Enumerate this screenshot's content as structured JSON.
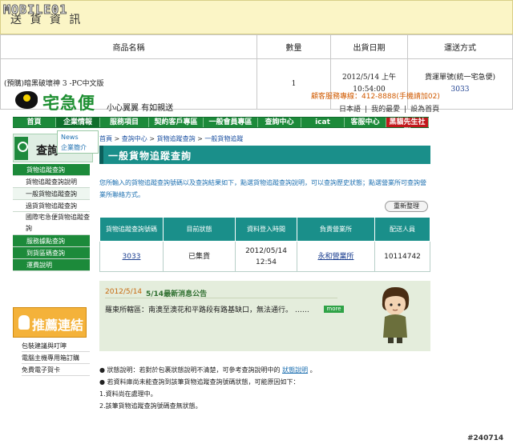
{
  "watermark": "MOBILE01",
  "shipping": {
    "title": "送 貨 資 訊",
    "headers": [
      "商品名稱",
      "數量",
      "出貨日期",
      "運送方式"
    ],
    "row": {
      "product": "(預購)暗黑破壞神 3 -PC中文版",
      "qty": "1",
      "date1": "2012/5/14 上午",
      "date2": "10:54:00",
      "method": "貨運單號(統一宅急便)",
      "tracking": "3033"
    }
  },
  "site": {
    "logo": "宅急便",
    "slogan": "小心翼翼 有如親送",
    "hotline": "顧客服務專線：412-8888(手機請加02)",
    "links": [
      "日本語",
      "我的最愛",
      "設為首頁"
    ],
    "nav": [
      "首頁",
      "企業情報",
      "服務項目",
      "契約客戶專區",
      "一般會員專區",
      "查詢中心",
      "icat",
      "客服中心",
      "黑貓先生社群"
    ],
    "dropdown": {
      "news": "News",
      "about": "企業簡介"
    }
  },
  "sidebar": {
    "title": "查詢",
    "items": [
      "貨物追蹤查詢",
      "貨物追蹤查詢說明",
      "一般貨物追蹤查詢",
      "過貨貨物追蹤查詢",
      "國際宅急便貨物追蹤查詢",
      "服務據點查詢",
      "到貨區碼查詢",
      "運費說明"
    ]
  },
  "recommend": {
    "title": "推薦連結",
    "items": [
      "包裝建議與叮嚀",
      "電腦主機專用箱訂購",
      "免費電子賀卡"
    ]
  },
  "main": {
    "breadcrumb": [
      "首頁",
      "查詢中心",
      "貨物追蹤查詢",
      "一般貨物追蹤"
    ],
    "heading": "一般貨物追蹤查詢",
    "desc": "您所輸入的貨物追蹤查詢號碼以及查詢結果如下，點選貨物追蹤查詢說明，可以查詢歷史狀態；點選營業所可查詢營業所聯絡方式。",
    "refresh": "重新整理",
    "table": {
      "headers": [
        "貨物追蹤查詢號碼",
        "目前狀態",
        "資料登入時間",
        "負責營業所",
        "配送人員"
      ],
      "row": {
        "no": "3033",
        "status": "已集貨",
        "time1": "2012/05/14",
        "time2": "12:54",
        "office": "永和營業所",
        "staff": "10114742"
      }
    },
    "news": {
      "date": "2012/5/14",
      "title": "5/14最新消息公告",
      "body": "羅東所轄區：南澳至澳花和平路段有路基缺口，無法通行。 ……",
      "more": "more"
    },
    "notes": {
      "n1a": "● 狀態說明：若對於包裹狀態說明不清楚，可參考查詢說明中的 ",
      "n1link": "狀態說明",
      "n1b": " 。",
      "n2": "● 若資料庫尚未能查詢到該筆貨物追蹤查詢號碼狀態，可能原因如下：",
      "n3": "1.資料尚在處理中。",
      "n4": "2.該筆貨物追蹤查詢號碼查無狀態。"
    }
  },
  "tag": "#240714"
}
